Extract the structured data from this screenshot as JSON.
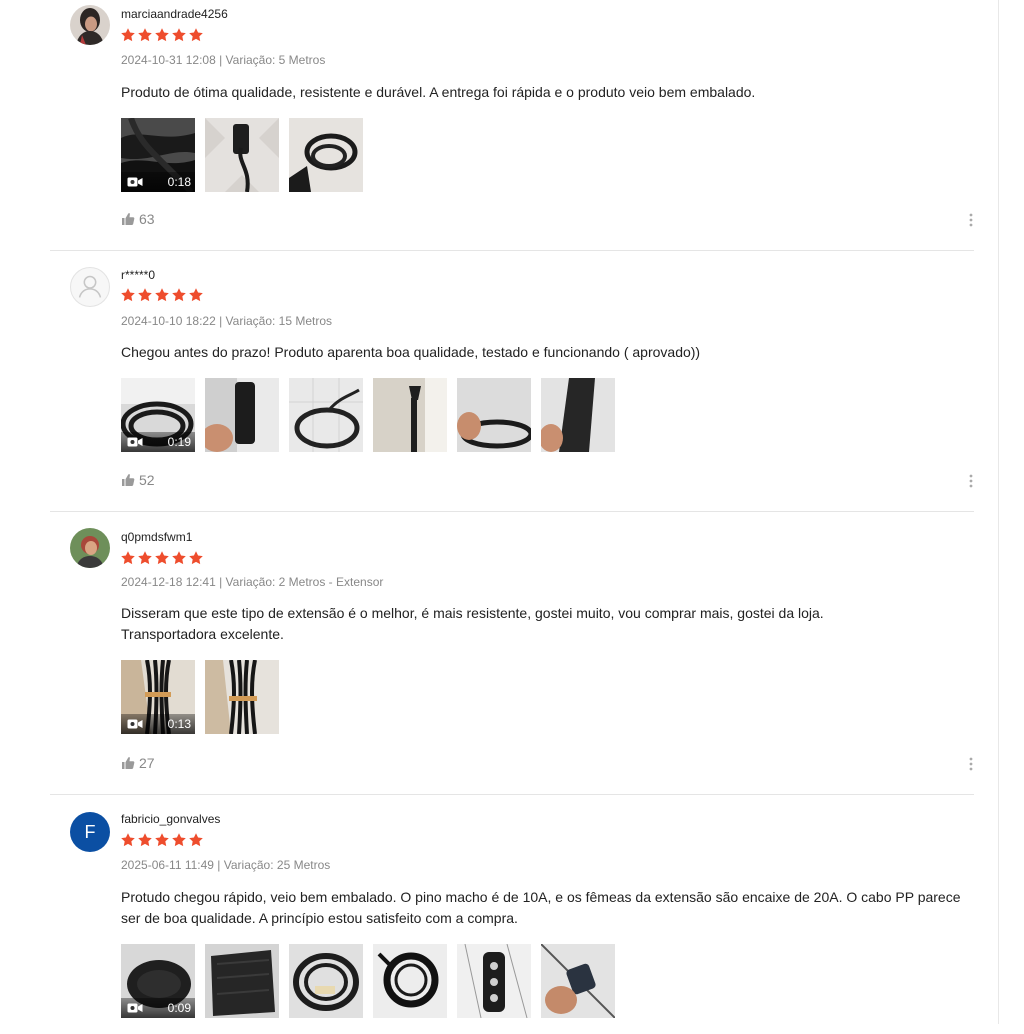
{
  "colors": {
    "star": "#ee4d2d",
    "meta": "#888888",
    "divider": "#e5e5e5",
    "avatar_initial_bg": "#0b4fa3"
  },
  "icons": {
    "star": "star-icon",
    "video": "video-camera-icon",
    "like": "thumbs-up-icon",
    "more": "more-vertical-icon",
    "default_avatar": "user-icon"
  },
  "reviews": [
    {
      "username": "marciaandrade4256",
      "rating": 5,
      "meta": "2024-10-31 12:08 | Variação: 5 Metros",
      "text": "Produto de ótima qualidade, resistente e durável. A entrega foi rápida e o produto veio bem embalado.",
      "video_duration": "0:18",
      "media_count": 3,
      "likes": "63"
    },
    {
      "username": "r*****0",
      "rating": 5,
      "meta": "2024-10-10 18:22 | Variação: 15 Metros",
      "text": "Chegou antes do prazo! Produto aparenta boa qualidade, testado e funcionando ( aprovado))",
      "video_duration": "0:19",
      "media_count": 6,
      "likes": "52"
    },
    {
      "username": "q0pmdsfwm1",
      "rating": 5,
      "meta": "2024-12-18 12:41 | Variação: 2 Metros - Extensor",
      "text_line1": "Disseram que este tipo de extensão é o melhor, é mais resistente, gostei muito, vou comprar mais, gostei da loja.",
      "text_line2": "Transportadora excelente.",
      "video_duration": "0:13",
      "media_count": 2,
      "likes": "27"
    },
    {
      "username": "fabricio_gonvalves",
      "avatar_initial": "F",
      "rating": 5,
      "meta": "2025-06-11 11:49 | Variação: 25 Metros",
      "text_line1": "Protudo chegou rápido, veio bem embalado. O pino macho é de 10A, e os fêmeas da extensão são encaixe de 20A. O cabo PP parece",
      "text_line2": "ser de boa qualidade. A princípio estou satisfeito com a compra.",
      "video_duration": "0:09",
      "media_count": 6
    }
  ]
}
